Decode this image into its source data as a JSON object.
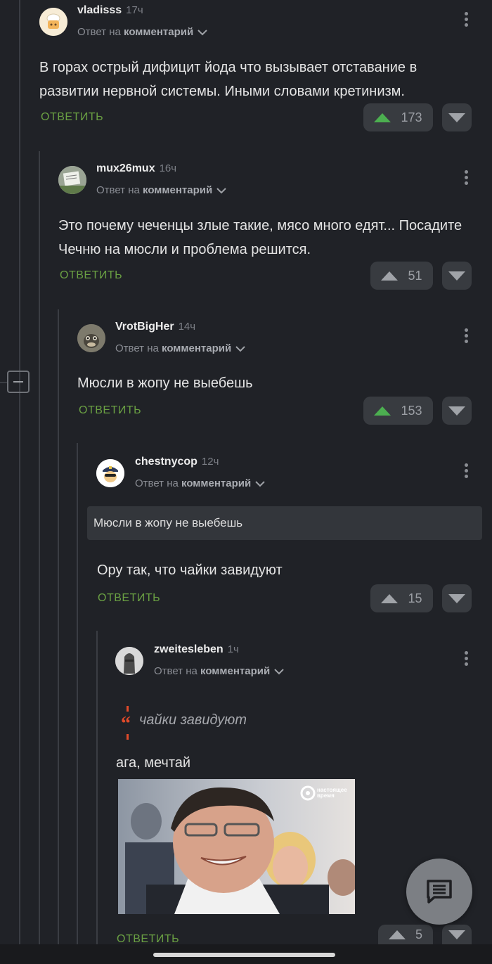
{
  "colors": {
    "background": "#202227",
    "reply_green": "#6aa043",
    "upvote_green": "#4caf50",
    "button_bg": "#383b40"
  },
  "comments": [
    {
      "username": "vladisss",
      "time": "17ч",
      "reply_prefix": "Ответ на",
      "reply_target": "комментарий",
      "text": "В горах острый дифицит йода что вызывает отставание в развитии нервной системы. Иными словами кретинизм.",
      "reply_label": "ОТВЕТИТЬ",
      "votes": "173",
      "upvoted": true
    },
    {
      "username": "mux26mux",
      "time": "16ч",
      "reply_prefix": "Ответ на",
      "reply_target": "комментарий",
      "text": "Это почему чеченцы злые такие, мясо много едят... Посадите Чечню на мюсли и проблема решится.",
      "reply_label": "ОТВЕТИТЬ",
      "votes": "51",
      "upvoted": false
    },
    {
      "username": "VrotBigHer",
      "time": "14ч",
      "reply_prefix": "Ответ на",
      "reply_target": "комментарий",
      "text": "Мюсли в жопу не выебешь",
      "reply_label": "ОТВЕТИТЬ",
      "votes": "153",
      "upvoted": true
    },
    {
      "username": "chestnycop",
      "time": "12ч",
      "reply_prefix": "Ответ на",
      "reply_target": "комментарий",
      "quote": "Мюсли в жопу не выебешь",
      "text": "Ору так, что чайки завидуют",
      "reply_label": "ОТВЕТИТЬ",
      "votes": "15",
      "upvoted": false
    },
    {
      "username": "zweitesleben",
      "time": "1ч",
      "reply_prefix": "Ответ на",
      "reply_target": "комментарий",
      "quote": "чайки завидуют",
      "text": "ага, мечтай",
      "image_watermark": "настоящее время",
      "reply_label": "ОТВЕТИТЬ",
      "votes": "5",
      "upvoted": false
    }
  ],
  "icons": {
    "collapse": "minus-square-icon",
    "fab": "comment-icon"
  }
}
